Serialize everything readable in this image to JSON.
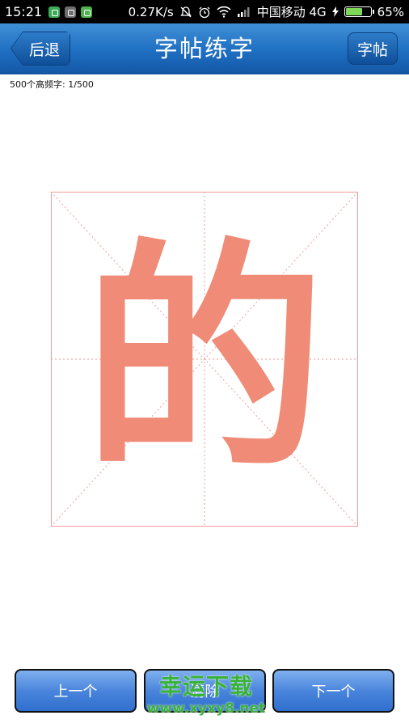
{
  "status_bar": {
    "time": "15:21",
    "network_speed": "0.27K/s",
    "carrier": "中国移动 4G",
    "battery": "65%",
    "battery_level": 0.65
  },
  "header": {
    "back_label": "后退",
    "title": "字帖练字",
    "right_label": "字帖"
  },
  "progress_text": "500个高频字: 1/500",
  "character": {
    "glyph": "的",
    "color": "#ef8b76"
  },
  "buttons": {
    "prev": "上一个",
    "middle": "清除",
    "next": "下一个"
  },
  "watermark": {
    "text": "幸运下载",
    "url": "www.xyxy8.net"
  }
}
